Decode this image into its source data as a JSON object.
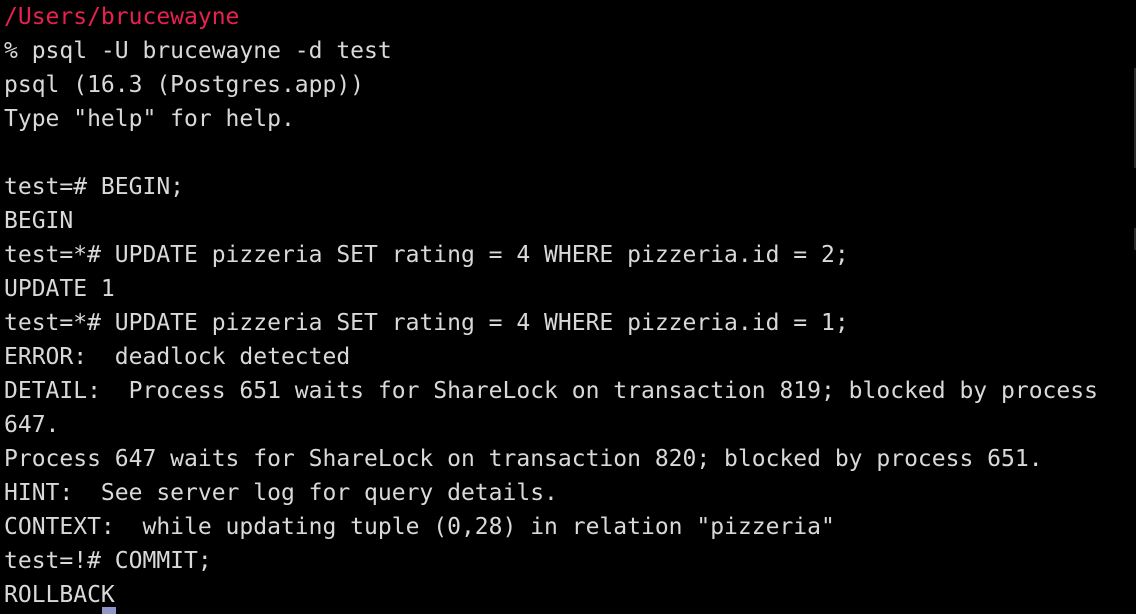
{
  "terminal": {
    "lines": [
      {
        "text": "/Users/brucewayne",
        "kind": "path"
      },
      {
        "text": "% psql -U brucewayne -d test",
        "kind": "command"
      },
      {
        "text": "psql (16.3 (Postgres.app))",
        "kind": "output"
      },
      {
        "text": "Type \"help\" for help.",
        "kind": "output"
      },
      {
        "text": "",
        "kind": "blank"
      },
      {
        "text": "test=# BEGIN;",
        "kind": "prompt"
      },
      {
        "text": "BEGIN",
        "kind": "output"
      },
      {
        "text": "test=*# UPDATE pizzeria SET rating = 4 WHERE pizzeria.id = 2;",
        "kind": "prompt"
      },
      {
        "text": "UPDATE 1",
        "kind": "output"
      },
      {
        "text": "test=*# UPDATE pizzeria SET rating = 4 WHERE pizzeria.id = 1;",
        "kind": "prompt"
      },
      {
        "text": "ERROR:  deadlock detected",
        "kind": "error"
      },
      {
        "text": "DETAIL:  Process 651 waits for ShareLock on transaction 819; blocked by process",
        "kind": "error"
      },
      {
        "text": "647.",
        "kind": "error"
      },
      {
        "text": "Process 647 waits for ShareLock on transaction 820; blocked by process 651.",
        "kind": "error"
      },
      {
        "text": "HINT:  See server log for query details.",
        "kind": "error"
      },
      {
        "text": "CONTEXT:  while updating tuple (0,28) in relation \"pizzeria\"",
        "kind": "error"
      },
      {
        "text": "test=!# COMMIT;",
        "kind": "prompt"
      },
      {
        "text": "ROLLBACK",
        "kind": "output"
      }
    ],
    "colors": {
      "background": "#000000",
      "text": "#d9d9d9",
      "path": "#e8214f",
      "cursor": "#8f95c9"
    }
  }
}
